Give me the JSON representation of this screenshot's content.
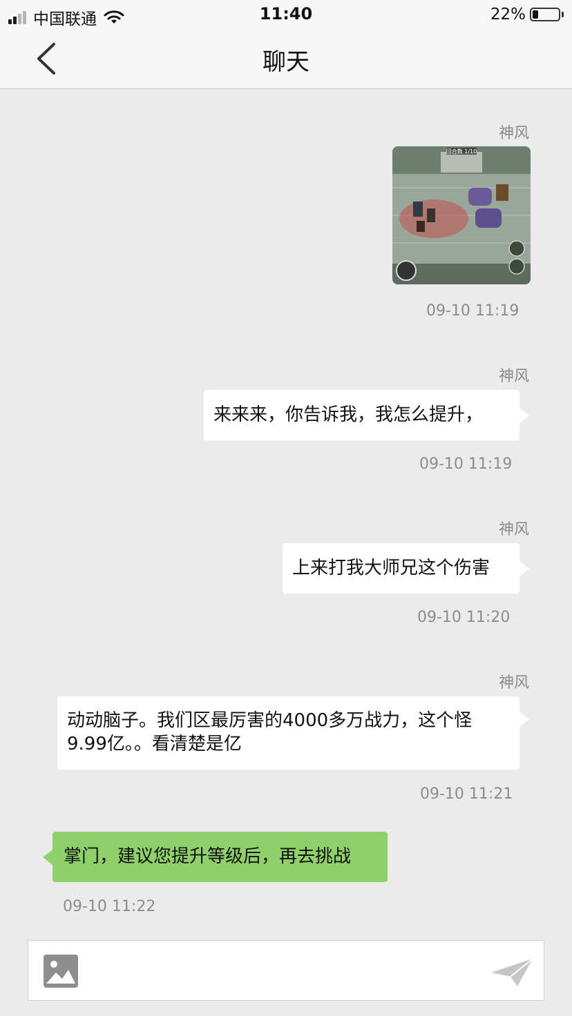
{
  "status_bar": {
    "carrier": "中国联通",
    "time": "11:40",
    "battery_percent_text": "22%",
    "battery_level": 0.22,
    "signal_bars": 4,
    "signal_bars_filled": 2
  },
  "nav": {
    "title": "聊天",
    "back_icon": "chevron-left-icon"
  },
  "messages": [
    {
      "sender": "神风",
      "type": "image",
      "image_caption": "回合数 1/10",
      "time": "09-10 11:19"
    },
    {
      "sender": "神风",
      "type": "text",
      "text": "来来来，你告诉我，我怎么提升，",
      "time": "09-10 11:19"
    },
    {
      "sender": "神风",
      "type": "text",
      "text": "上来打我大师兄这个伤害",
      "time": "09-10 11:20"
    },
    {
      "sender": "神风",
      "type": "text",
      "text": "动动脑子。我们区最厉害的4000多万战力，这个怪9.99亿。。看清楚是亿",
      "time": "09-10 11:21"
    },
    {
      "sender": "",
      "type": "text",
      "text": "掌门，建议您提升等级后，再去挑战",
      "time": "09-10 11:22"
    }
  ],
  "input_bar": {
    "image_icon": "image-icon",
    "send_icon": "send-icon"
  },
  "colors": {
    "background": "#ebebeb",
    "header": "#f7f7f7",
    "reply_bubble": "#8fd06b",
    "incoming_bubble": "#ffffff",
    "meta_text": "#8c8c8c"
  }
}
